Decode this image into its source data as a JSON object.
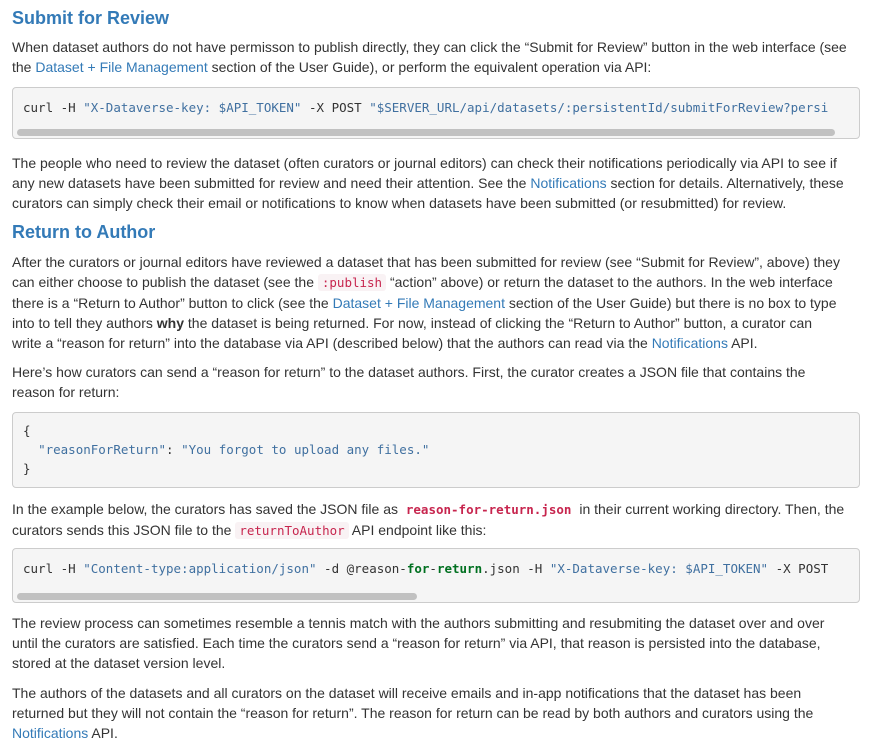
{
  "section1": {
    "title": "Submit for Review",
    "intro": {
      "l1": "When dataset authors do not have permisson to publish directly, they can click the “Submit for Review” button in the web interface (see",
      "l2a": "the ",
      "link": "Dataset + File Management",
      "l2b": " section of the User Guide), or perform the equivalent operation via API:"
    },
    "code": {
      "a": "curl -H ",
      "b": "\"X-Dataverse-key: $API_TOKEN\"",
      "c": " -X POST ",
      "d": "\"$SERVER_URL/api/datasets/:persistentId/submitForReview?persi"
    },
    "followup": {
      "l1": "The people who need to review the dataset (often curators or journal editors) can check their notifications periodically via API to see if",
      "l2a": "any new datasets have been submitted for review and need their attention. See the ",
      "link": "Notifications",
      "l2b": " section for details. Alternatively, these",
      "l3": "curators can simply check their email or notifications to know when datasets have been submitted (or resubmitted) for review."
    }
  },
  "section2": {
    "title": "Return to Author",
    "p1": {
      "l1": "After the curators or journal editors have reviewed a dataset that has been submitted for review (see “Submit for Review”, above) they",
      "l2a": "can either choose to publish the dataset (see the ",
      "code": ":publish",
      "l2b": " “action” above) or return the dataset to the authors. In the web interface",
      "l3a": "there is a “Return to Author” button to click (see the ",
      "link": "Dataset + File Management",
      "l3b": " section of the User Guide) but there is no box to type",
      "l4a": "into to tell they authors ",
      "bold": "why",
      "l4b": " the dataset is being returned. For now, instead of clicking the “Return to Author” button, a curator can",
      "l5a": "write a “reason for return” into the database via API (described below) that the authors can read via the ",
      "link2": "Notifications",
      "l5b": " API."
    },
    "p2": {
      "l1": "Here’s how curators can send a “reason for return” to the dataset authors. First, the curator creates a JSON file that contains the",
      "l2": "reason for return:"
    },
    "json": {
      "open": "{",
      "key": "\"reasonForReturn\"",
      "colon": ": ",
      "value": "\"You forgot to upload any files.\"",
      "close": "}"
    },
    "p3": {
      "l1a": "In the example below, the curators has saved the JSON file as ",
      "file": "reason-for-return.json",
      "l1b": " in their current working directory. Then, the",
      "l2a": "curators sends this JSON file to the ",
      "endpoint": "returnToAuthor",
      "l2b": " API endpoint like this:"
    },
    "code2": {
      "a": "curl -H ",
      "b": "\"Content-type:application/json\"",
      "c": " -d @reason-",
      "d": "for",
      "e": "-",
      "f": "return",
      "g": ".json -H ",
      "h": "\"X-Dataverse-key: $API_TOKEN\"",
      "i": " -X POST"
    },
    "p4": {
      "l1": "The review process can sometimes resemble a tennis match with the authors submitting and resubmiting the dataset over and over",
      "l2": "until the curators are satisfied. Each time the curators send a “reason for return” via API, that reason is persisted into the database,",
      "l3": "stored at the dataset version level."
    },
    "p5": {
      "l1": "The authors of the datasets and all curators on the dataset will receive emails and in-app notifications that the dataset has been",
      "l2": "returned but they will not contain the “reason for return”. The reason for return can be read by both authors and curators using the",
      "link": "Notifications",
      "l3b": " API."
    }
  }
}
